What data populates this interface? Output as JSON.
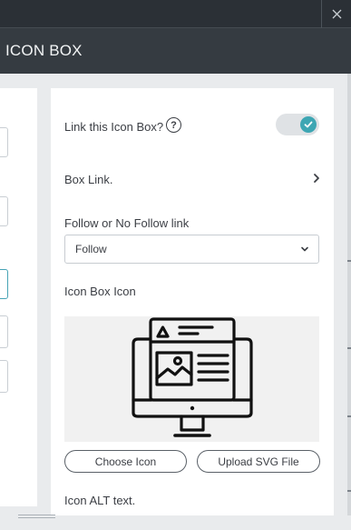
{
  "header": {
    "title": "ICON BOX"
  },
  "link_box": {
    "label": "Link this Icon Box?",
    "help_glyph": "?",
    "enabled": true,
    "toggle_color": "#3da6b3"
  },
  "box_link": {
    "label": "Box Link."
  },
  "follow": {
    "label": "Follow or No Follow link",
    "selected": "Follow"
  },
  "icon_box_icon": {
    "label": "Icon Box Icon",
    "icon": "monitor-webpage-icon",
    "choose_button": "Choose Icon",
    "upload_button": "Upload SVG File"
  },
  "alt_text": {
    "label": "Icon ALT text."
  },
  "colors": {
    "topbar": "#2b3036",
    "titlebar": "#353b41",
    "accent": "#3da6b3"
  }
}
